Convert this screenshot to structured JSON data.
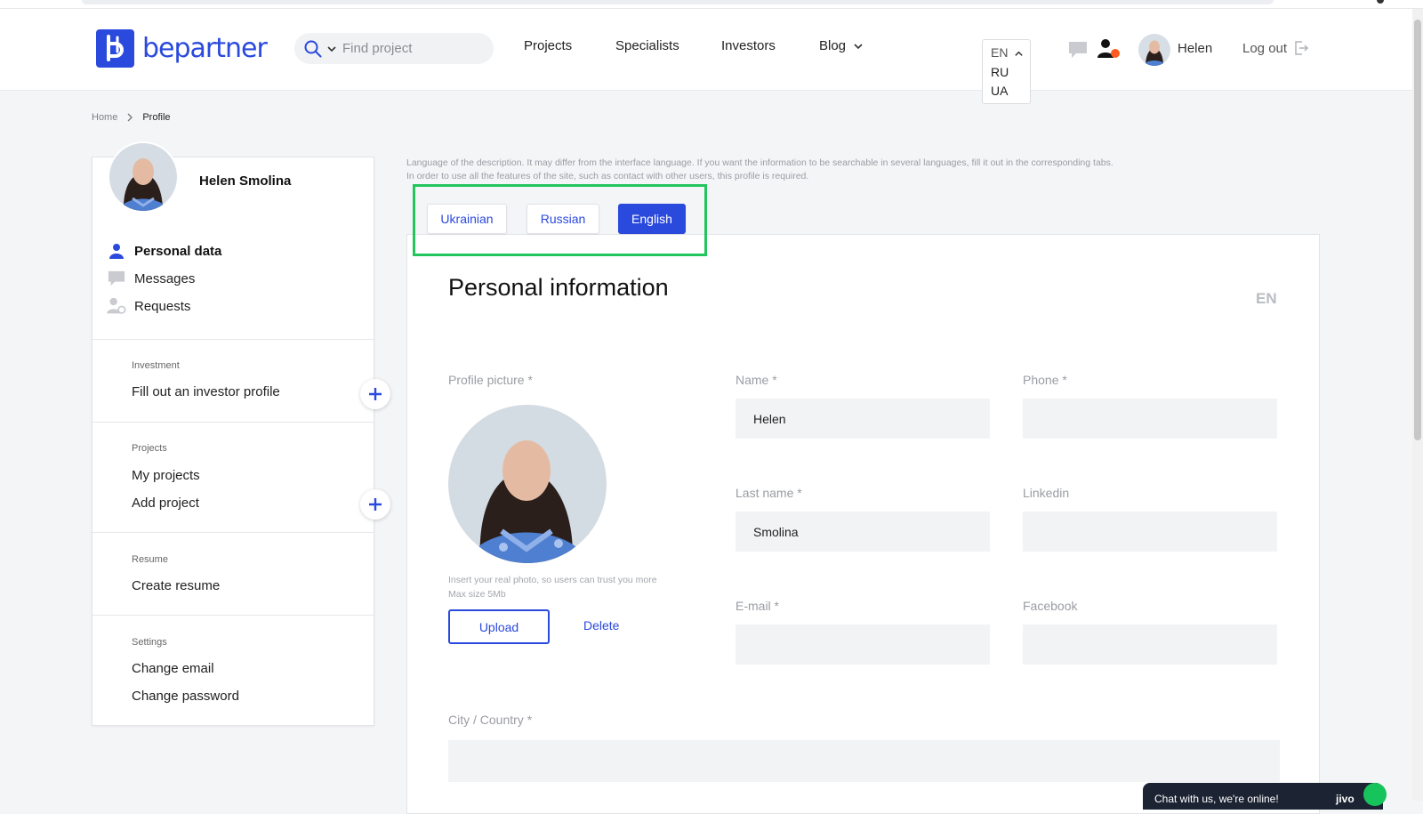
{
  "header": {
    "logo_text": "bepartner",
    "search_placeholder": "Find project",
    "nav": [
      "Projects",
      "Specialists",
      "Investors",
      "Blog"
    ],
    "languages": [
      "EN",
      "RU",
      "UA"
    ],
    "user_name": "Helen",
    "logout_label": "Log out"
  },
  "breadcrumb": {
    "home": "Home",
    "current": "Profile"
  },
  "sidebar": {
    "user_full_name": "Helen Smolina",
    "menu": [
      "Personal data",
      "Messages",
      "Requests"
    ],
    "sections": {
      "investment": {
        "label": "Investment",
        "items": [
          "Fill out an investor profile"
        ]
      },
      "projects": {
        "label": "Projects",
        "items": [
          "My projects",
          "Add project"
        ]
      },
      "resume": {
        "label": "Resume",
        "items": [
          "Create resume"
        ]
      },
      "settings": {
        "label": "Settings",
        "items": [
          "Change email",
          "Change password"
        ]
      }
    }
  },
  "main": {
    "lang_hint_line1": "Language of the description. It may differ from the interface language. If you want the information to be searchable in several languages, fill it out in the corresponding tabs.",
    "lang_hint_line2": "In order to use all the features of the site, such as contact with other users, this profile is required.",
    "tabs": [
      "Ukrainian",
      "Russian",
      "English"
    ],
    "active_tab": "English",
    "title": "Personal information",
    "lang_badge": "EN",
    "fields": {
      "profile_picture_label": "Profile picture *",
      "photo_hint_line1": "Insert your real photo, so users can trust you more",
      "photo_hint_line2": "Max size 5Mb",
      "upload_label": "Upload",
      "delete_label": "Delete",
      "name_label": "Name *",
      "name_value": "Helen",
      "phone_label": "Phone *",
      "phone_value": "",
      "last_name_label": "Last name *",
      "last_name_value": "Smolina",
      "linkedin_label": "Linkedin",
      "linkedin_value": "",
      "email_label": "E-mail *",
      "email_value": "",
      "facebook_label": "Facebook",
      "facebook_value": "",
      "city_label": "City / Country *",
      "city_value": ""
    }
  },
  "chat": {
    "text": "Chat with us, we're online!",
    "brand": "jivo"
  },
  "colors": {
    "brand": "#2a49dd",
    "highlight": "#22c55e",
    "notification": "#ff5a1f"
  }
}
